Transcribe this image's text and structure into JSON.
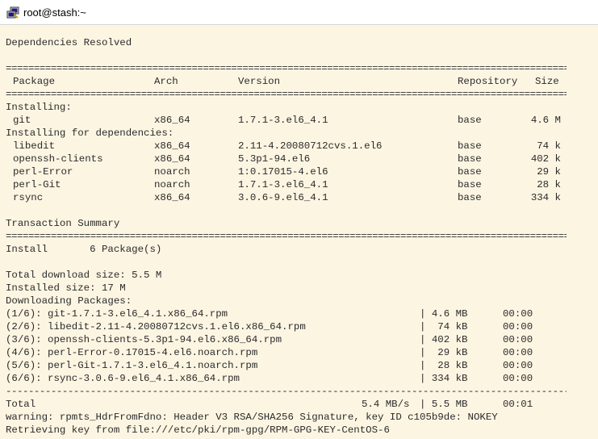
{
  "window": {
    "title": "root@stash:~",
    "icon": "putty-icon"
  },
  "terminal": {
    "dependencies_resolved": "Dependencies Resolved",
    "rule_double": "==========================================================================================================",
    "rule_single": "----------------------------------------------------------------------------------------------------------",
    "headers": {
      "package": "Package",
      "arch": "Arch",
      "version": "Version",
      "repository": "Repository",
      "size": "Size"
    },
    "installing_label": "Installing:",
    "installing": [
      {
        "package": "git",
        "arch": "x86_64",
        "version": "1.7.1-3.el6_4.1",
        "repo": "base",
        "size": "4.6 M"
      }
    ],
    "deps_label": "Installing for dependencies:",
    "deps": [
      {
        "package": "libedit",
        "arch": "x86_64",
        "version": "2.11-4.20080712cvs.1.el6",
        "repo": "base",
        "size": "74 k"
      },
      {
        "package": "openssh-clients",
        "arch": "x86_64",
        "version": "5.3p1-94.el6",
        "repo": "base",
        "size": "402 k"
      },
      {
        "package": "perl-Error",
        "arch": "noarch",
        "version": "1:0.17015-4.el6",
        "repo": "base",
        "size": "29 k"
      },
      {
        "package": "perl-Git",
        "arch": "noarch",
        "version": "1.7.1-3.el6_4.1",
        "repo": "base",
        "size": "28 k"
      },
      {
        "package": "rsync",
        "arch": "x86_64",
        "version": "3.0.6-9.el6_4.1",
        "repo": "base",
        "size": "334 k"
      }
    ],
    "transaction_summary": "Transaction Summary",
    "install_line": "Install       6 Package(s)",
    "total_download": "Total download size: 5.5 M",
    "installed_size": "Installed size: 17 M",
    "downloading": "Downloading Packages:",
    "downloads": [
      {
        "file": "(1/6): git-1.7.1-3.el6_4.1.x86_64.rpm",
        "size": "| 4.6 MB",
        "time": "00:00"
      },
      {
        "file": "(2/6): libedit-2.11-4.20080712cvs.1.el6.x86_64.rpm",
        "size": "|  74 kB",
        "time": "00:00"
      },
      {
        "file": "(3/6): openssh-clients-5.3p1-94.el6.x86_64.rpm",
        "size": "| 402 kB",
        "time": "00:00"
      },
      {
        "file": "(4/6): perl-Error-0.17015-4.el6.noarch.rpm",
        "size": "|  29 kB",
        "time": "00:00"
      },
      {
        "file": "(5/6): perl-Git-1.7.1-3.el6_4.1.noarch.rpm",
        "size": "|  28 kB",
        "time": "00:00"
      },
      {
        "file": "(6/6): rsync-3.0.6-9.el6_4.1.x86_64.rpm",
        "size": "| 334 kB",
        "time": "00:00"
      }
    ],
    "total": {
      "label": "Total",
      "speed": "5.4 MB/s",
      "size": "| 5.5 MB",
      "time": "00:01"
    },
    "warning": "warning: rpmts_HdrFromFdno: Header V3 RSA/SHA256 Signature, key ID c105b9de: NOKEY",
    "retrieving": "Retrieving key from file:///etc/pki/rpm-gpg/RPM-GPG-KEY-CentOS-6"
  }
}
